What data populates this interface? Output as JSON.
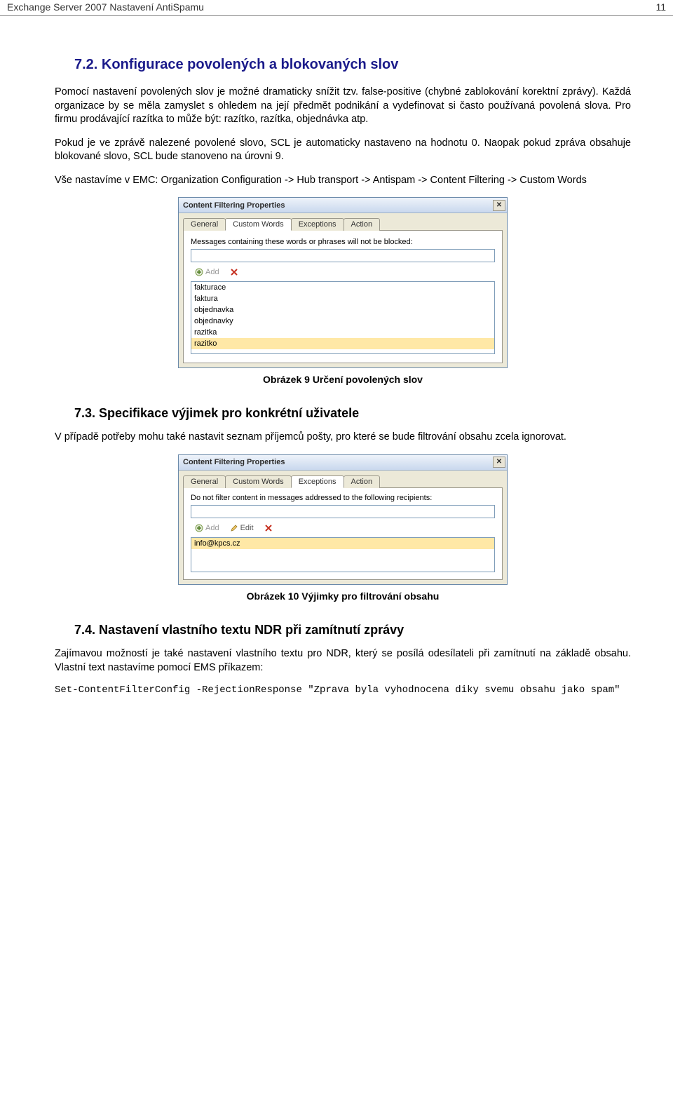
{
  "header": {
    "title": "Exchange Server 2007 Nastavení AntiSpamu",
    "page_number": "11"
  },
  "sec72": {
    "heading": "7.2. Konfigurace povolených a blokovaných slov",
    "p1": "Pomocí nastavení povolených slov je možné dramaticky snížit tzv. false-positive (chybné zablokování korektní zprávy). Každá organizace by se měla zamyslet s ohledem na její předmět podnikání a vydefinovat si často používaná povolená slova. Pro firmu prodávající razítka to může být: razítko, razítka, objednávka atp.",
    "p2": "Pokud je ve zprávě nalezené povolené slovo, SCL je automaticky nastaveno na hodnotu 0. Naopak pokud zpráva obsahuje blokované slovo, SCL bude stanoveno na úrovni 9.",
    "p3": "Vše nastavíme v EMC: Organization Configuration -> Hub transport -> Antispam -> Content Filtering -> Custom Words"
  },
  "dialog1": {
    "title": "Content Filtering Properties",
    "tabs": [
      "General",
      "Custom Words",
      "Exceptions",
      "Action"
    ],
    "active_tab": 1,
    "panel_label": "Messages containing these words or phrases will not be blocked:",
    "input_value": "",
    "add_label": "Add",
    "list_items": [
      "fakturace",
      "faktura",
      "objednavka",
      "objednavky",
      "razitka",
      "razitko"
    ],
    "selected_index": 5
  },
  "caption1": "Obrázek 9 Určení povolených slov",
  "sec73": {
    "heading": "7.3. Specifikace výjimek pro konkrétní uživatele",
    "p1": "V případě potřeby mohu také nastavit seznam příjemců pošty, pro které se bude filtrování obsahu zcela ignorovat."
  },
  "dialog2": {
    "title": "Content Filtering Properties",
    "tabs": [
      "General",
      "Custom Words",
      "Exceptions",
      "Action"
    ],
    "active_tab": 2,
    "panel_label": "Do not filter content in messages addressed to the following recipients:",
    "input_value": "",
    "add_label": "Add",
    "edit_label": "Edit",
    "list_items": [
      "info@kpcs.cz"
    ],
    "selected_index": 0
  },
  "caption2": "Obrázek 10 Výjimky pro filtrování obsahu",
  "sec74": {
    "heading": "7.4. Nastavení vlastního textu NDR při zamítnutí zprávy",
    "p1": "Zajímavou možností je také nastavení vlastního textu pro NDR, který se posílá odesílateli při zamítnutí na základě obsahu. Vlastní text nastavíme pomocí EMS příkazem:",
    "cmd": "Set-ContentFilterConfig -RejectionResponse \"Zprava byla vyhodnocena diky svemu obsahu jako spam\""
  }
}
